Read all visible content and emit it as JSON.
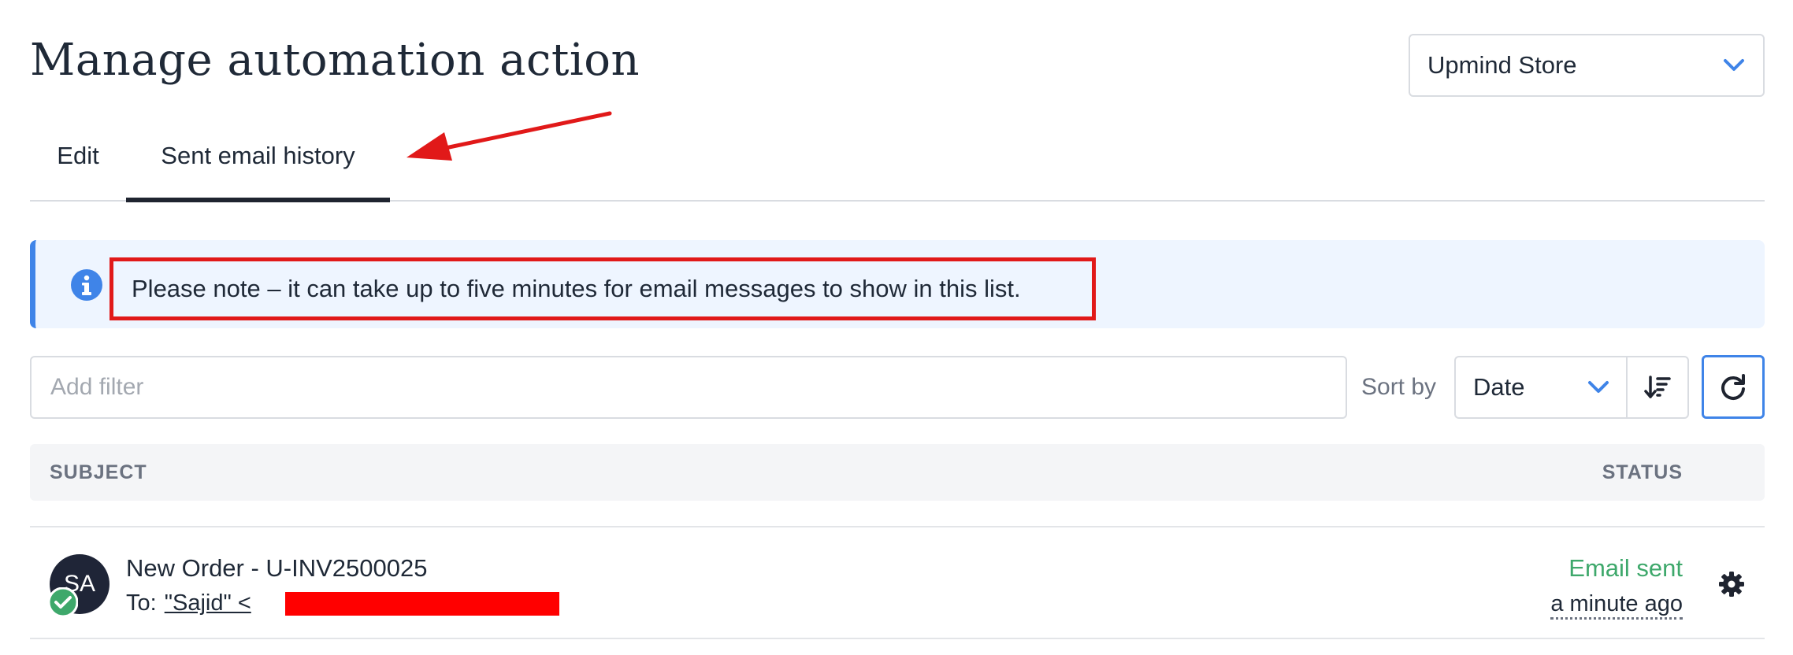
{
  "header": {
    "title": "Manage automation action",
    "store_select": "Upmind Store"
  },
  "tabs": [
    {
      "label": "Edit",
      "active": false
    },
    {
      "label": "Sent email history",
      "active": true
    }
  ],
  "info_banner": {
    "text": "Please note – it can take up to five minutes for email messages to show in this list."
  },
  "filter": {
    "placeholder": "Add filter",
    "value": ""
  },
  "sort": {
    "label": "Sort by",
    "selected": "Date"
  },
  "table": {
    "columns": [
      "SUBJECT",
      "STATUS"
    ],
    "rows": [
      {
        "avatar_initials": "SA",
        "subject": "New Order - U-INV2500025",
        "to_prefix": "To:",
        "to_name": "\"Sajid\" <",
        "to_suffix": ">",
        "status": "Email sent",
        "time": "a minute ago"
      }
    ]
  },
  "colors": {
    "accent": "#3f84e8",
    "success": "#3ea86b",
    "annotation": "#e11919",
    "banner_bg": "#eef5ff"
  },
  "icons": {
    "store_select": "chevron-down-icon",
    "info": "info-circle-icon",
    "sort_select": "chevron-down-icon",
    "sort_direction": "sort-descending-icon",
    "refresh": "refresh-icon",
    "avatar_badge": "check-circle-icon",
    "row_action": "gear-icon",
    "annotation": "arrow-icon"
  }
}
